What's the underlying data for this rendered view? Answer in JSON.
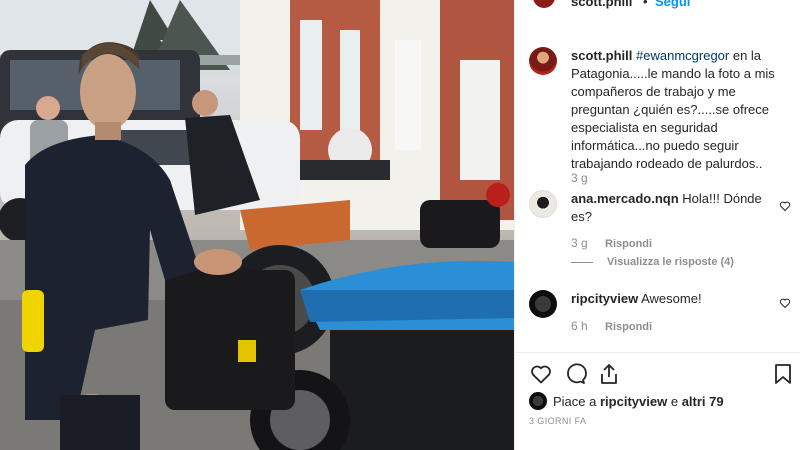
{
  "header": {
    "username": "scott.phill",
    "separator": "•",
    "follow_label": "Segui"
  },
  "caption": {
    "username": "scott.phill",
    "hashtag": "#ewanmcgregor",
    "text": " en la Patagonia.....le mando la foto a mis compañeros de trabajo y me preguntan ¿quién es?.....se ofrece especialista en seguridad informática...no puedo seguir trabajando rodeado de palurdos..",
    "time": "3 g"
  },
  "comments": [
    {
      "username": "ana.mercado.nqn",
      "text": "Hola!!! Dónde es?",
      "time": "3 g",
      "reply_label": "Rispondi",
      "view_replies": "Visualizza le risposte (4)",
      "avatar_icon": "avatar-image"
    },
    {
      "username": "ripcityview",
      "text": "Awesome!",
      "time": "6 h",
      "reply_label": "Rispondi",
      "avatar_icon": "avatar-image"
    }
  ],
  "actions": {
    "icons": [
      "heart-icon",
      "comment-icon",
      "share-icon",
      "bookmark-icon"
    ]
  },
  "likes": {
    "prefix": "Piace a ",
    "user": "ripcityview",
    "middle": " e ",
    "others": "altri 79"
  },
  "timestamp": "3 GIORNI FA",
  "colors": {
    "link_blue": "#0095f6",
    "hashtag": "#00376b",
    "muted": "#8e8e8e",
    "text": "#262626"
  }
}
